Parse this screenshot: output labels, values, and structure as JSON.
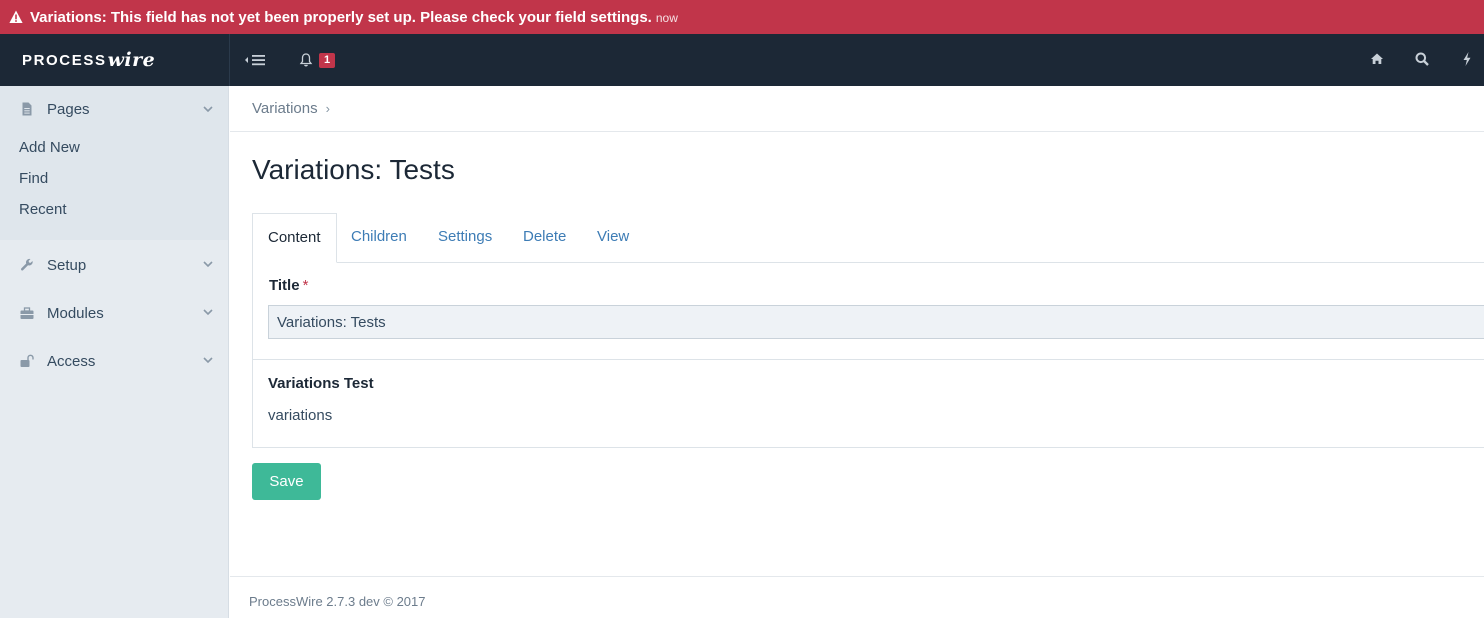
{
  "alert": {
    "message": "Variations: This field has not yet been properly set up. Please check your field settings.",
    "time": "now",
    "icon": "warning-icon",
    "color": "#c1354a"
  },
  "masthead": {
    "logo_part1": "PROCESS",
    "logo_part2": "wire",
    "notifications_count": "1",
    "icons": [
      "menu-toggle-icon",
      "bell-icon",
      "home-icon",
      "search-icon",
      "lightning-icon"
    ]
  },
  "sidebar": {
    "pages": {
      "label": "Pages",
      "items": [
        "Add New",
        "Find",
        "Recent"
      ]
    },
    "setup": {
      "label": "Setup"
    },
    "modules": {
      "label": "Modules"
    },
    "access": {
      "label": "Access"
    }
  },
  "breadcrumb": {
    "item": "Variations",
    "separator": "›"
  },
  "page_title": "Variations: Tests",
  "tabs": [
    "Content",
    "Children",
    "Settings",
    "Delete",
    "View"
  ],
  "form": {
    "title_label": "Title",
    "required_mark": "*",
    "title_value": "Variations: Tests",
    "field2_label": "Variations Test",
    "field2_value": "variations"
  },
  "save_label": "Save",
  "footer": "ProcessWire 2.7.3 dev © 2017",
  "colors": {
    "masthead": "#1c2836",
    "accent_link": "#3d7cb5",
    "save_button": "#3eb998",
    "sidebar": "#e6ebf0"
  }
}
